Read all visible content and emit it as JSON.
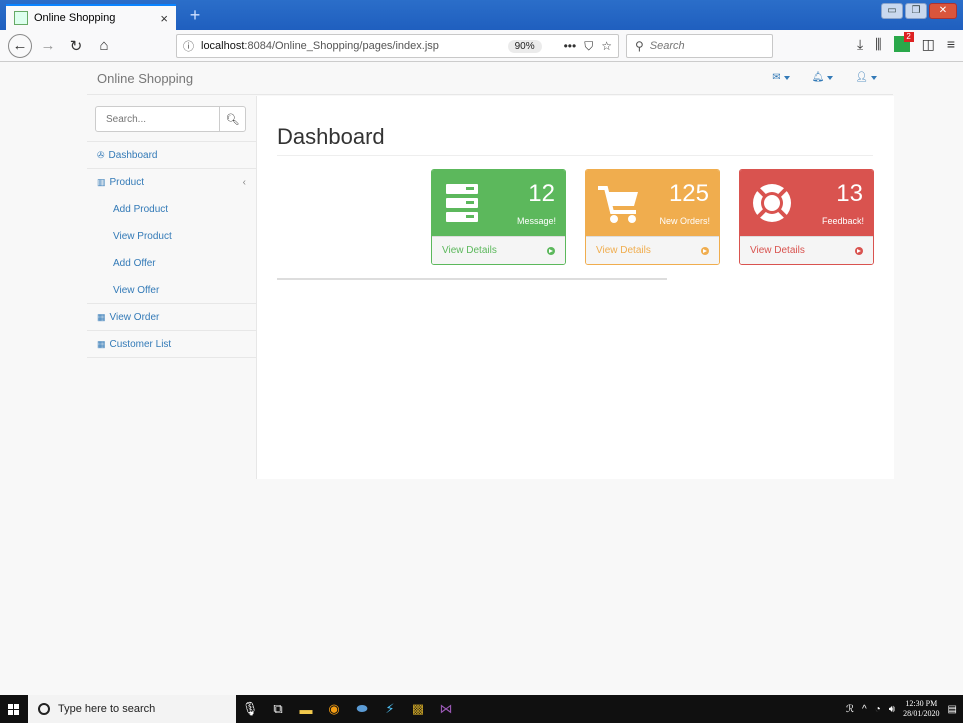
{
  "browser": {
    "tab_title": "Online Shopping",
    "tab_close": "×",
    "new_tab": "+",
    "url_prefix": "localhost",
    "url_rest": ":8084/Online_Shopping/pages/index.jsp",
    "zoom": "90%",
    "more": "•••",
    "search_placeholder": "Search"
  },
  "app": {
    "brand": "Online Shopping"
  },
  "sidebar": {
    "search_placeholder": "Search...",
    "items": [
      {
        "label": "Dashboard",
        "icon": "dashboard-icon"
      },
      {
        "label": "Product",
        "icon": "bar-chart-icon"
      },
      {
        "label": "View Order",
        "icon": "table-icon"
      },
      {
        "label": "Customer List",
        "icon": "table-icon"
      }
    ],
    "product_submenu": [
      "Add Product",
      "View Product",
      "Add Offer",
      "View Offer"
    ]
  },
  "main": {
    "title": "Dashboard",
    "panels": [
      {
        "count": "12",
        "label": "Message!",
        "footer": "View Details",
        "color": "#5cb85c",
        "icon": "server-icon"
      },
      {
        "count": "125",
        "label": "New Orders!",
        "footer": "View Details",
        "color": "#f0ad4e",
        "icon": "cart-icon"
      },
      {
        "count": "13",
        "label": "Feedback!",
        "footer": "View Details",
        "color": "#d9534f",
        "icon": "lifebuoy-icon"
      }
    ]
  },
  "taskbar": {
    "search_text": "Type here to search",
    "time": "12:30 PM",
    "date": "28/01/2020"
  }
}
